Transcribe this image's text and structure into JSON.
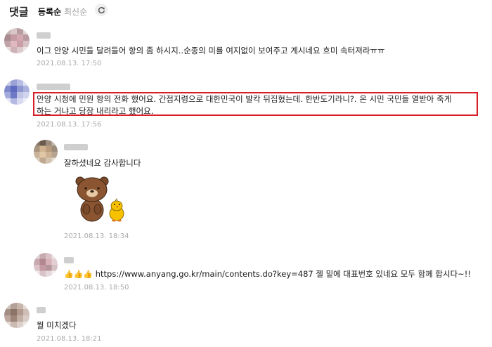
{
  "header": {
    "title": "댓글",
    "sort_active": "등록순",
    "sort_inactive": "최신순"
  },
  "comments": [
    {
      "text": "이그 안양 시민들 달려들어 항의 좀 하시지..순종의 미를 여지없이 보여주고 계시네요 흐미 속터져라ㅠㅠ",
      "date": "2021.08.13. 17:50"
    },
    {
      "line1": "안양 시청에 민원 항의 전화 했어요. 간접지령으로 대한민국이 발칵 뒤집혔는데. 한반도기라니?. 온 시민 국민들 열받아 죽게",
      "line2": "하는 거냐고 당장 내리라고 했어요.",
      "date": "2021.08.13. 17:56",
      "highlighted": true,
      "highlight_color": "#d81e28"
    },
    {
      "text": "잘하셨네요 감사합니다",
      "date": "2021.08.13. 18:34",
      "sticker": "brown-bear-and-chick-sticker",
      "reply": true
    },
    {
      "thumbs": "👍👍👍",
      "text": "https://www.anyang.go.kr/main/contents.do?key=487 젤 밑에 대표번호 있네요 모두 함께 합시다~!!",
      "date": "2021.08.13. 18:50",
      "reply": true
    },
    {
      "text": "뭘 미치겠다",
      "date": "2021.08.13. 18:21"
    }
  ],
  "icons": {
    "refresh": "refresh-icon"
  }
}
